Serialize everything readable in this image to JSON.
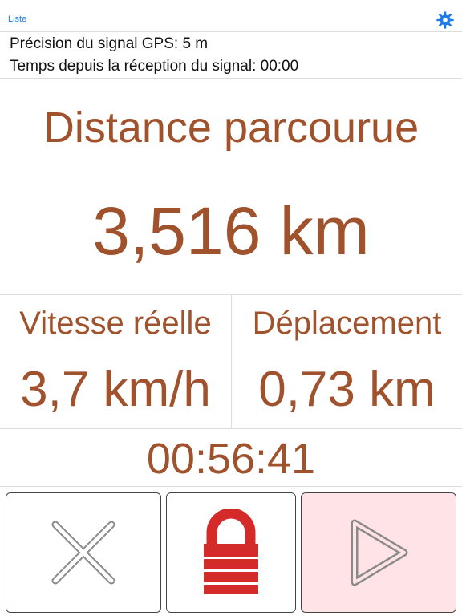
{
  "nav": {
    "list_link": "Liste",
    "settings_icon": "gear-icon"
  },
  "status": {
    "gps_precision": "Précision du signal GPS: 5 m",
    "time_since_signal": "Temps depuis la réception du signal: 00:00"
  },
  "distance": {
    "title": "Distance parcourue",
    "value": "3,516 km"
  },
  "speed": {
    "label": "Vitesse réelle",
    "value": "3,7 km/h"
  },
  "displacement": {
    "label": "Déplacement",
    "value": "0,73 km"
  },
  "elapsed_time": "00:56:41",
  "controls": {
    "reset_icon": "close-icon",
    "lock_icon": "lock-icon",
    "play_icon": "play-icon"
  },
  "colors": {
    "accent_text": "#a0522d",
    "link": "#1f7be6",
    "lock": "#d42a2a",
    "play_button_bg": "#ffe3e6"
  }
}
